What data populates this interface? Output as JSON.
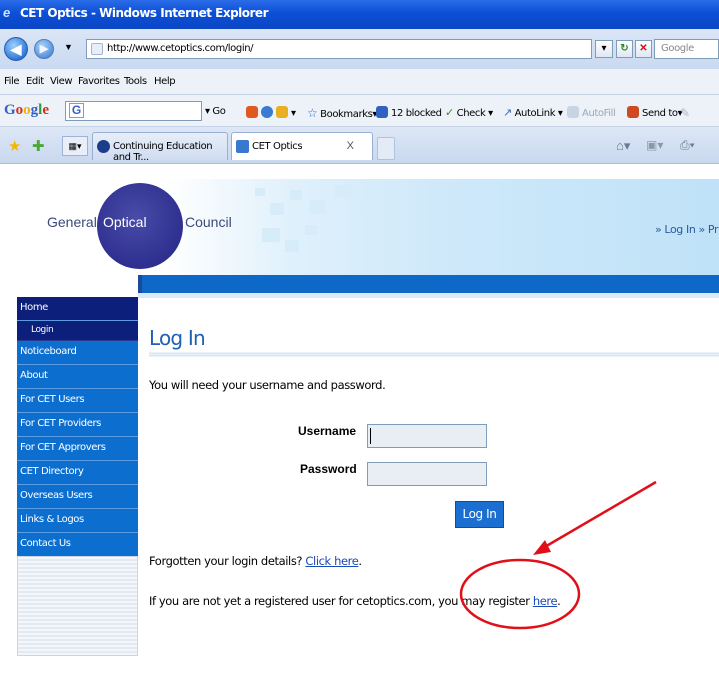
{
  "window": {
    "title": "CET Optics - Windows Internet Explorer"
  },
  "address_bar": {
    "url": "http://www.cetoptics.com/login/",
    "search_placeholder": "Google"
  },
  "menu": [
    "File",
    "Edit",
    "View",
    "Favorites",
    "Tools",
    "Help"
  ],
  "google_toolbar": {
    "go": "Go",
    "bookmarks": "Bookmarks",
    "blocked": "12 blocked",
    "check": "Check",
    "autolink": "AutoLink",
    "autofill": "AutoFill",
    "send_to": "Send to"
  },
  "tabs": [
    {
      "label": "Continuing Education and Tr..."
    },
    {
      "label": "CET Optics"
    }
  ],
  "site": {
    "logo": {
      "general": "General",
      "optical": "Optical",
      "council": "Council"
    },
    "top_links": "» Log In  » Priv",
    "nav": [
      "Home",
      "Login",
      "Noticeboard",
      "About",
      "For CET Users",
      "For CET Providers",
      "For CET Approvers",
      "CET Directory",
      "Overseas Users",
      "Links & Logos",
      "Contact Us"
    ],
    "page_title": "Log In",
    "intro": "You will need your username and password.",
    "username_label": "Username",
    "password_label": "Password",
    "login_button": "Log In",
    "forgot_text": "Forgotten your login details?",
    "forgot_link": "Click here",
    "forgot_end": ".",
    "register_text": "If you are not yet a registered user for cetoptics.com, you may register",
    "register_link": "here",
    "register_end": "."
  },
  "colors": {
    "annotation": "#e0101a",
    "nav_blue": "#0c6fd0",
    "nav_dark": "#0c1f7a",
    "title_blue": "#1f5fb4"
  }
}
